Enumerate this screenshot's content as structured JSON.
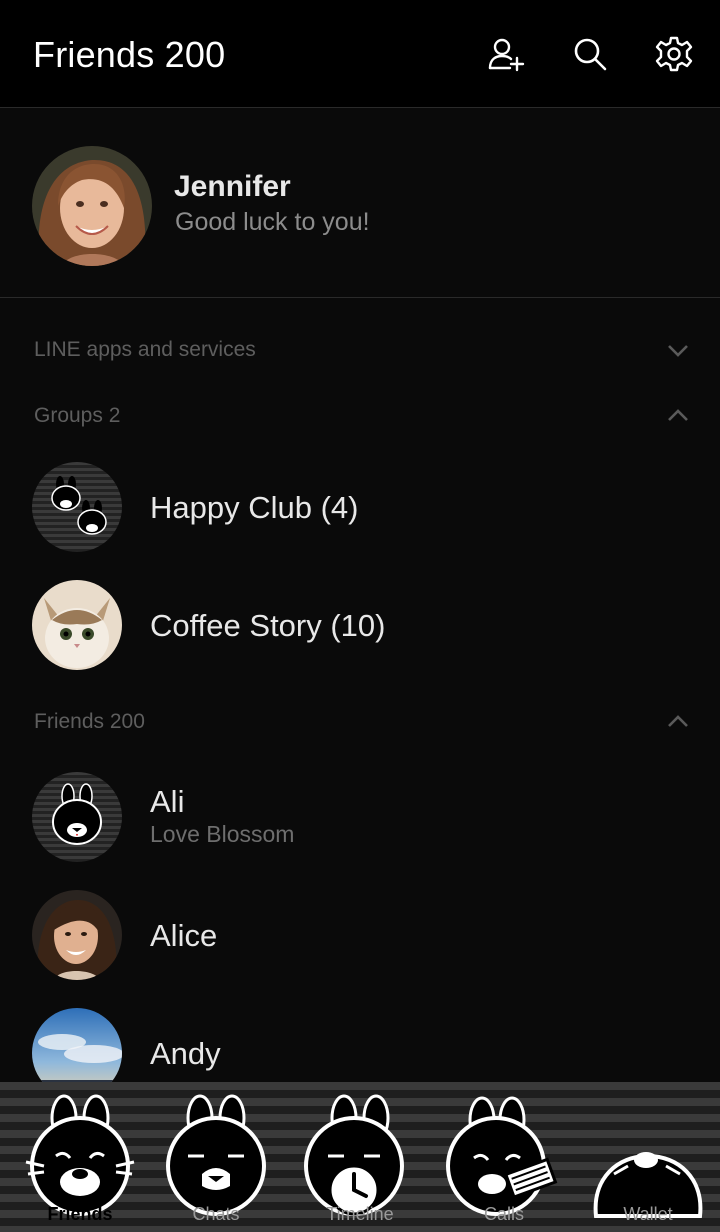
{
  "header": {
    "title": "Friends 200",
    "icons": [
      "add-friend-icon",
      "search-icon",
      "settings-icon"
    ]
  },
  "profile": {
    "name": "Jennifer",
    "status": "Good luck to you!"
  },
  "sections": {
    "services": "LINE apps and services",
    "groups": "Groups 2",
    "friends": "Friends 200"
  },
  "groups": [
    {
      "name": "Happy Club (4)"
    },
    {
      "name": "Coffee Story (10)"
    }
  ],
  "friends": [
    {
      "name": "Ali",
      "status": "Love Blossom"
    },
    {
      "name": "Alice"
    },
    {
      "name": "Andy"
    }
  ],
  "tabs": [
    {
      "label": "Friends",
      "icon": "bunny-friends-icon",
      "active": true
    },
    {
      "label": "Chats",
      "icon": "bunny-chats-icon"
    },
    {
      "label": "Timeline",
      "icon": "bunny-clock-icon"
    },
    {
      "label": "Calls",
      "icon": "bunny-calls-icon"
    },
    {
      "label": "Wallet",
      "icon": "bunny-wallet-icon"
    }
  ],
  "colors": {
    "background": "#0a0a0a",
    "header": "#000000",
    "muted_text": "#5e5e5e"
  }
}
